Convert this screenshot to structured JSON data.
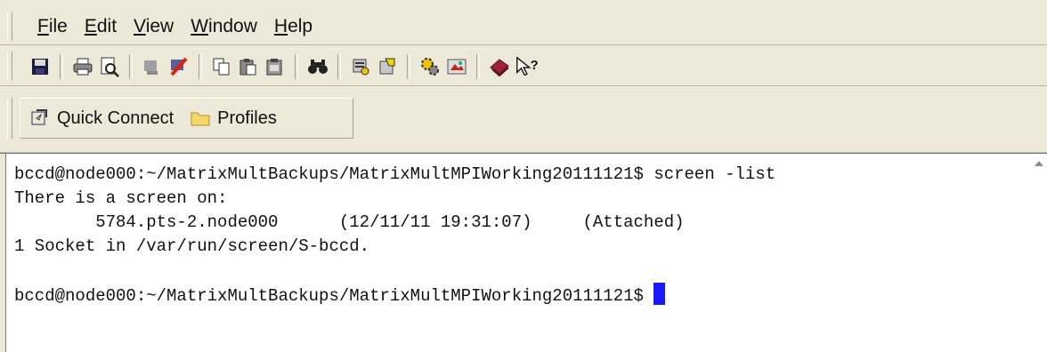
{
  "menu": {
    "file": {
      "mnemonic": "F",
      "rest": "ile"
    },
    "edit": {
      "mnemonic": "E",
      "rest": "dit"
    },
    "view": {
      "mnemonic": "V",
      "rest": "iew"
    },
    "window": {
      "mnemonic": "W",
      "rest": "indow"
    },
    "help": {
      "mnemonic": "H",
      "rest": "elp"
    }
  },
  "quickbar": {
    "quick_connect": "Quick Connect",
    "profiles": "Profiles"
  },
  "terminal": {
    "lines": [
      "bccd@node000:~/MatrixMultBackups/MatrixMultMPIWorking20111121$ screen -list",
      "There is a screen on:",
      "        5784.pts-2.node000      (12/11/11 19:31:07)     (Attached)",
      "1 Socket in /var/run/screen/S-bccd.",
      "",
      "bccd@node000:~/MatrixMultBackups/MatrixMultMPIWorking20111121$ "
    ]
  },
  "icons": [
    "save-icon",
    "print-icon",
    "print-preview-icon",
    "connect-icon",
    "disconnect-icon",
    "copy-icon",
    "paste-icon",
    "paste-special-icon",
    "find-icon",
    "settings-icon",
    "session-options-icon",
    "keymap-icon",
    "sftp-icon",
    "help-book-icon",
    "context-help-icon",
    "quick-connect-icon",
    "folder-icon"
  ],
  "colors": {
    "cursor": "#1a1aff",
    "chrome": "#ece9d8"
  }
}
